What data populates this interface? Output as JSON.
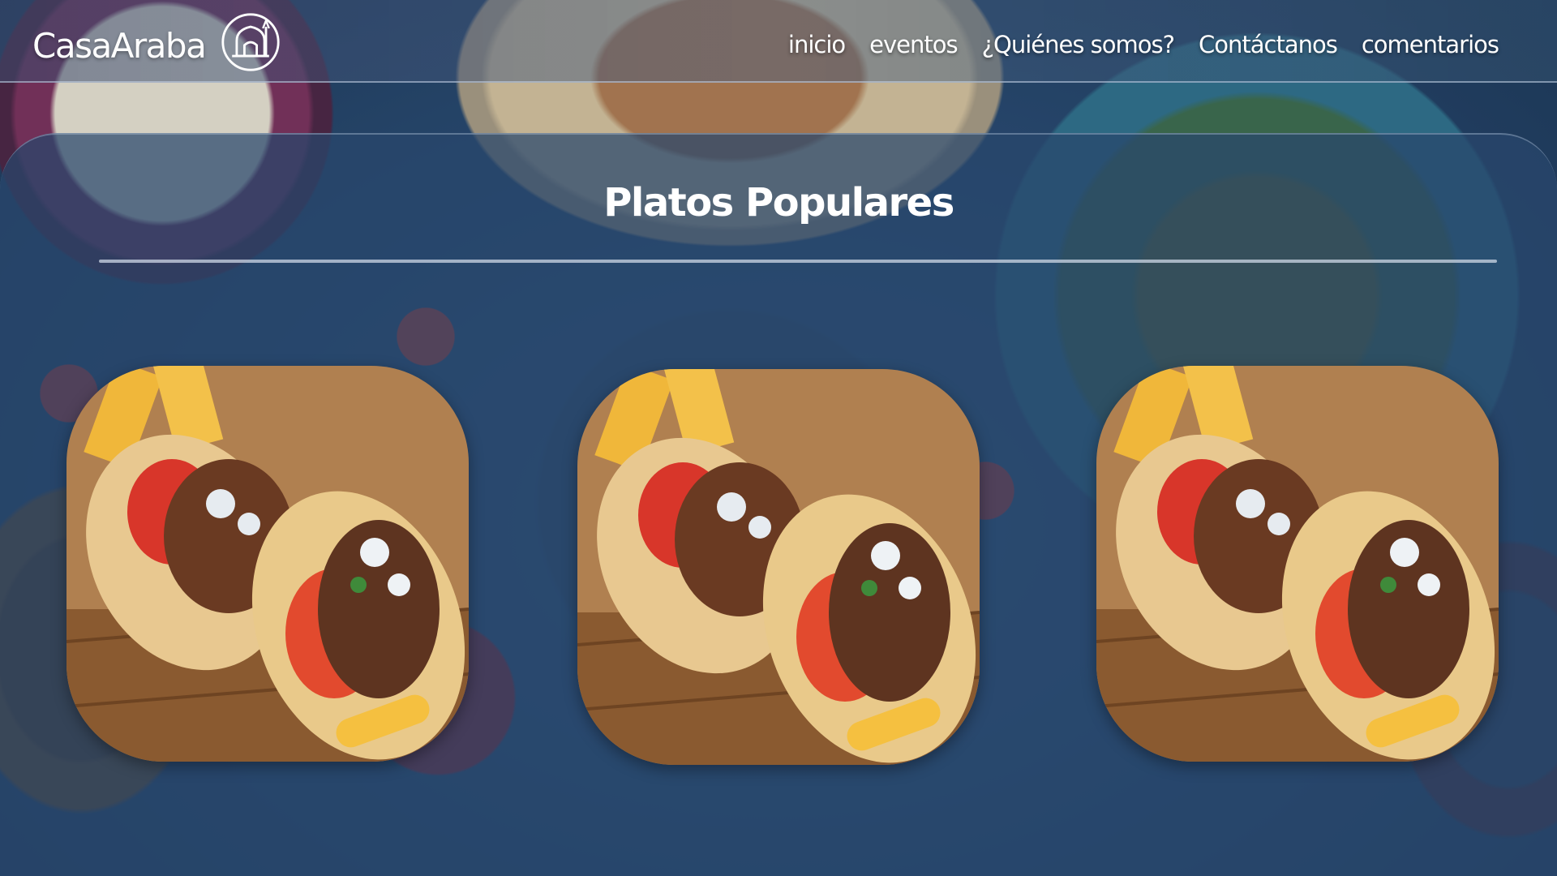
{
  "brand": {
    "name": "CasaAraba",
    "logo_icon": "mosque-icon"
  },
  "nav": {
    "items": [
      {
        "label": "inicio"
      },
      {
        "label": "eventos"
      },
      {
        "label": "¿Quiénes somos?"
      },
      {
        "label": "Contáctanos"
      },
      {
        "label": "comentarios"
      }
    ]
  },
  "section": {
    "title": "Platos Populares",
    "dishes": [
      {
        "image": "gyro-wrap-image"
      },
      {
        "image": "gyro-wrap-image"
      },
      {
        "image": "gyro-wrap-image"
      }
    ]
  },
  "colors": {
    "panel": "#284c72",
    "text": "#ffffff",
    "divider": "#cdd7e6"
  }
}
